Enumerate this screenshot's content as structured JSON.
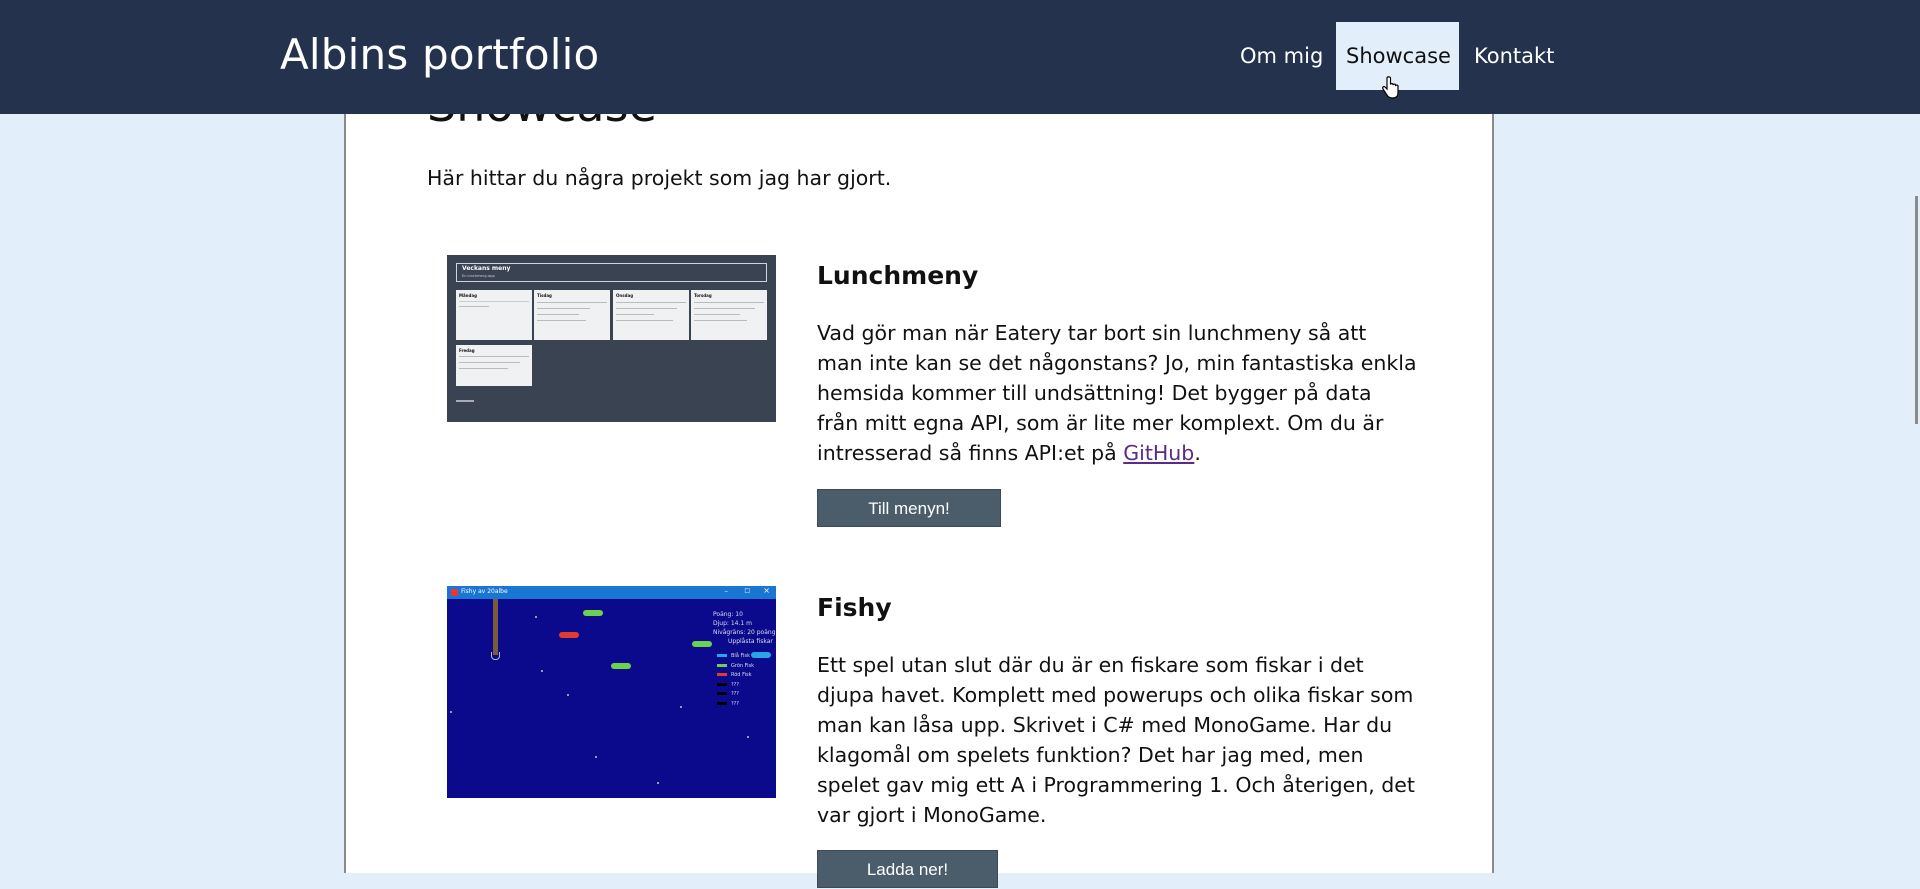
{
  "site": {
    "title": "Albins portfolio"
  },
  "nav": {
    "items": [
      {
        "label": "Om mig",
        "active": false
      },
      {
        "label": "Showcase",
        "active": true
      },
      {
        "label": "Kontakt",
        "active": false
      }
    ]
  },
  "page": {
    "heading": "Showcase",
    "intro": "Här hittar du några projekt som jag har gjort."
  },
  "projects": [
    {
      "title": "Lunchmeny",
      "desc_before": "Vad gör man när Eatery tar bort sin lunchmeny så att man inte kan se det någonstans? Jo, min fantastiska enkla hemsida kommer till undsättning! Det bygger på data från mitt egna API, som är lite mer komplext. Om du är intresserad så finns API:et på ",
      "link_text": "GitHub",
      "desc_after": ".",
      "button": "Till menyn!",
      "thumb": {
        "title": "Veckans meny",
        "subtitle": "En lunchmeny-app",
        "days": [
          "Måndag",
          "Tisdag",
          "Onsdag",
          "Torsdag",
          "Fredag"
        ]
      }
    },
    {
      "title": "Fishy",
      "desc": "Ett spel utan slut där du är en fiskare som fiskar i det djupa havet. Komplett med powerups och olika fiskar som man kan låsa upp. Skrivet i C# med MonoGame. Har du klagomål om spelets funktion? Det har jag med, men spelet gav mig ett A i Programmering 1. Och återigen, det var gjort i MonoGame.",
      "button": "Ladda ner!",
      "thumb": {
        "window_title": "Fishy av 20albe",
        "hud": [
          "Poäng: 10",
          "Djup: 14.1 m",
          "Nivågräns: 20 poäng",
          "Upplåsta fiskar"
        ],
        "fish_list": [
          "Blå Fisk",
          "Grön Fisk",
          "Röd Fisk",
          "???",
          "???",
          "???"
        ]
      }
    }
  ],
  "colors": {
    "navbar": "#24324d",
    "background": "#e2effa",
    "button": "#4b5d6b",
    "link": "#5b2b86",
    "game_bg": "#0b0a8c",
    "menu_bg": "#3a4351"
  }
}
